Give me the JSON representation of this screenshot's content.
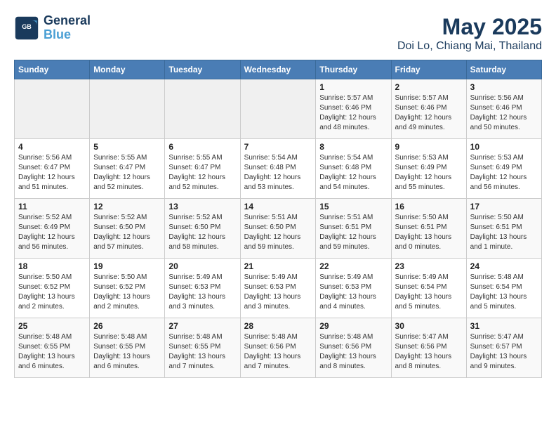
{
  "header": {
    "logo_line1": "General",
    "logo_line2": "Blue",
    "month_title": "May 2025",
    "location": "Doi Lo, Chiang Mai, Thailand"
  },
  "weekdays": [
    "Sunday",
    "Monday",
    "Tuesday",
    "Wednesday",
    "Thursday",
    "Friday",
    "Saturday"
  ],
  "weeks": [
    [
      {
        "day": "",
        "info": ""
      },
      {
        "day": "",
        "info": ""
      },
      {
        "day": "",
        "info": ""
      },
      {
        "day": "",
        "info": ""
      },
      {
        "day": "1",
        "info": "Sunrise: 5:57 AM\nSunset: 6:46 PM\nDaylight: 12 hours\nand 48 minutes."
      },
      {
        "day": "2",
        "info": "Sunrise: 5:57 AM\nSunset: 6:46 PM\nDaylight: 12 hours\nand 49 minutes."
      },
      {
        "day": "3",
        "info": "Sunrise: 5:56 AM\nSunset: 6:46 PM\nDaylight: 12 hours\nand 50 minutes."
      }
    ],
    [
      {
        "day": "4",
        "info": "Sunrise: 5:56 AM\nSunset: 6:47 PM\nDaylight: 12 hours\nand 51 minutes."
      },
      {
        "day": "5",
        "info": "Sunrise: 5:55 AM\nSunset: 6:47 PM\nDaylight: 12 hours\nand 52 minutes."
      },
      {
        "day": "6",
        "info": "Sunrise: 5:55 AM\nSunset: 6:47 PM\nDaylight: 12 hours\nand 52 minutes."
      },
      {
        "day": "7",
        "info": "Sunrise: 5:54 AM\nSunset: 6:48 PM\nDaylight: 12 hours\nand 53 minutes."
      },
      {
        "day": "8",
        "info": "Sunrise: 5:54 AM\nSunset: 6:48 PM\nDaylight: 12 hours\nand 54 minutes."
      },
      {
        "day": "9",
        "info": "Sunrise: 5:53 AM\nSunset: 6:49 PM\nDaylight: 12 hours\nand 55 minutes."
      },
      {
        "day": "10",
        "info": "Sunrise: 5:53 AM\nSunset: 6:49 PM\nDaylight: 12 hours\nand 56 minutes."
      }
    ],
    [
      {
        "day": "11",
        "info": "Sunrise: 5:52 AM\nSunset: 6:49 PM\nDaylight: 12 hours\nand 56 minutes."
      },
      {
        "day": "12",
        "info": "Sunrise: 5:52 AM\nSunset: 6:50 PM\nDaylight: 12 hours\nand 57 minutes."
      },
      {
        "day": "13",
        "info": "Sunrise: 5:52 AM\nSunset: 6:50 PM\nDaylight: 12 hours\nand 58 minutes."
      },
      {
        "day": "14",
        "info": "Sunrise: 5:51 AM\nSunset: 6:50 PM\nDaylight: 12 hours\nand 59 minutes."
      },
      {
        "day": "15",
        "info": "Sunrise: 5:51 AM\nSunset: 6:51 PM\nDaylight: 12 hours\nand 59 minutes."
      },
      {
        "day": "16",
        "info": "Sunrise: 5:50 AM\nSunset: 6:51 PM\nDaylight: 13 hours\nand 0 minutes."
      },
      {
        "day": "17",
        "info": "Sunrise: 5:50 AM\nSunset: 6:51 PM\nDaylight: 13 hours\nand 1 minute."
      }
    ],
    [
      {
        "day": "18",
        "info": "Sunrise: 5:50 AM\nSunset: 6:52 PM\nDaylight: 13 hours\nand 2 minutes."
      },
      {
        "day": "19",
        "info": "Sunrise: 5:50 AM\nSunset: 6:52 PM\nDaylight: 13 hours\nand 2 minutes."
      },
      {
        "day": "20",
        "info": "Sunrise: 5:49 AM\nSunset: 6:53 PM\nDaylight: 13 hours\nand 3 minutes."
      },
      {
        "day": "21",
        "info": "Sunrise: 5:49 AM\nSunset: 6:53 PM\nDaylight: 13 hours\nand 3 minutes."
      },
      {
        "day": "22",
        "info": "Sunrise: 5:49 AM\nSunset: 6:53 PM\nDaylight: 13 hours\nand 4 minutes."
      },
      {
        "day": "23",
        "info": "Sunrise: 5:49 AM\nSunset: 6:54 PM\nDaylight: 13 hours\nand 5 minutes."
      },
      {
        "day": "24",
        "info": "Sunrise: 5:48 AM\nSunset: 6:54 PM\nDaylight: 13 hours\nand 5 minutes."
      }
    ],
    [
      {
        "day": "25",
        "info": "Sunrise: 5:48 AM\nSunset: 6:55 PM\nDaylight: 13 hours\nand 6 minutes."
      },
      {
        "day": "26",
        "info": "Sunrise: 5:48 AM\nSunset: 6:55 PM\nDaylight: 13 hours\nand 6 minutes."
      },
      {
        "day": "27",
        "info": "Sunrise: 5:48 AM\nSunset: 6:55 PM\nDaylight: 13 hours\nand 7 minutes."
      },
      {
        "day": "28",
        "info": "Sunrise: 5:48 AM\nSunset: 6:56 PM\nDaylight: 13 hours\nand 7 minutes."
      },
      {
        "day": "29",
        "info": "Sunrise: 5:48 AM\nSunset: 6:56 PM\nDaylight: 13 hours\nand 8 minutes."
      },
      {
        "day": "30",
        "info": "Sunrise: 5:47 AM\nSunset: 6:56 PM\nDaylight: 13 hours\nand 8 minutes."
      },
      {
        "day": "31",
        "info": "Sunrise: 5:47 AM\nSunset: 6:57 PM\nDaylight: 13 hours\nand 9 minutes."
      }
    ]
  ]
}
